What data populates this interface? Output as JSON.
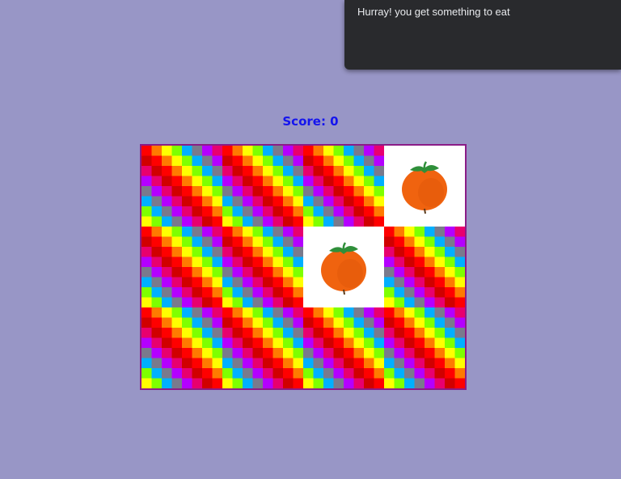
{
  "alert": {
    "message": "Hurray! you get something to eat"
  },
  "score": {
    "label": "Score: 0"
  },
  "board": {
    "rows": 3,
    "cols": 4,
    "tiles": [
      "hidden",
      "hidden",
      "hidden",
      "tomato",
      "hidden",
      "hidden",
      "tomato",
      "hidden",
      "hidden",
      "hidden",
      "hidden",
      "hidden"
    ]
  },
  "colors": {
    "background": "#9896c6",
    "alert_bg": "#292a2d",
    "alert_text": "#e8eaed",
    "score_text": "#1414ee",
    "board_border": "#8b1c87",
    "tomato": "#f0630f",
    "stem": "#2f8f3a",
    "tile_rainbow": [
      "#ff0000",
      "#ff7a00",
      "#ffff00",
      "#7fff00",
      "#00b0ff",
      "#7a7a8c",
      "#b400ff",
      "#e8006e",
      "#d00000"
    ]
  }
}
